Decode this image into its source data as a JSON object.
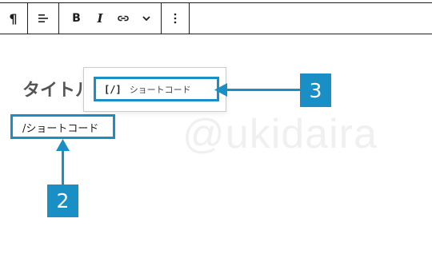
{
  "toolbar": {
    "buttons": [
      {
        "name": "paragraph",
        "icon": "pilcrow-icon",
        "glyph": "¶"
      },
      {
        "name": "align",
        "icon": "align-left-icon"
      },
      {
        "name": "bold",
        "icon": "bold-icon",
        "glyph": "B"
      },
      {
        "name": "italic",
        "icon": "italic-icon",
        "glyph": "I"
      },
      {
        "name": "link",
        "icon": "link-icon"
      },
      {
        "name": "more-formatting",
        "icon": "chevron-down-icon"
      },
      {
        "name": "options",
        "icon": "more-vertical-icon",
        "glyph": "⋮"
      }
    ]
  },
  "editor": {
    "title": "タイトル",
    "typed_text": "/ショートコード",
    "watermark": "@ukidaira"
  },
  "inserter": {
    "item_icon_label": "[/]",
    "item_label": "ショートコード"
  },
  "callouts": [
    {
      "number": "2"
    },
    {
      "number": "3"
    }
  ],
  "colors": {
    "accent": "#1a8fc5",
    "toolbar_border": "#1e1e1e",
    "title_text": "#555555"
  }
}
